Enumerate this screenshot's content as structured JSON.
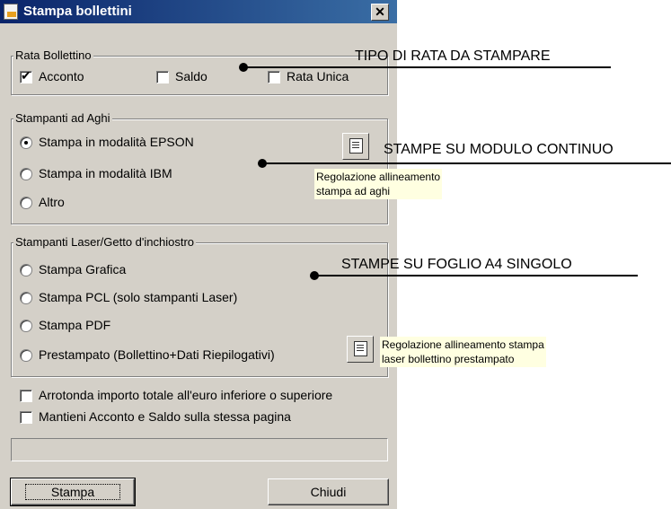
{
  "window": {
    "title": "Stampa bollettini",
    "close_glyph": "✕"
  },
  "rata": {
    "legend": "Rata Bollettino",
    "acconto": {
      "label": "Acconto",
      "checked": true
    },
    "saldo": {
      "label": "Saldo",
      "checked": false
    },
    "unica": {
      "label": "Rata Unica",
      "checked": false
    }
  },
  "aghi": {
    "legend": "Stampanti ad Aghi",
    "options": [
      {
        "label": "Stampa in modalità EPSON",
        "selected": true
      },
      {
        "label": "Stampa in modalità IBM",
        "selected": false
      },
      {
        "label": "Altro",
        "selected": false
      }
    ],
    "tooltip_line1": "Regolazione allineamento",
    "tooltip_line2": "stampa ad aghi"
  },
  "laser": {
    "legend": "Stampanti Laser/Getto d'inchiostro",
    "options": [
      {
        "label": "Stampa Grafica",
        "selected": false
      },
      {
        "label": "Stampa PCL (solo stampanti Laser)",
        "selected": false
      },
      {
        "label": "Stampa PDF",
        "selected": false
      },
      {
        "label": "Prestampato (Bollettino+Dati Riepilogativi)",
        "selected": false
      }
    ],
    "tooltip_line1": "Regolazione allineamento stampa",
    "tooltip_line2": "laser bollettino prestampato"
  },
  "options": {
    "arrotonda": "Arrotonda importo totale all'euro inferiore o superiore",
    "mantieni": "Mantieni Acconto e Saldo sulla stessa pagina"
  },
  "buttons": {
    "stampa": "Stampa",
    "chiudi": "Chiudi"
  },
  "annotations": {
    "tipo": "TIPO DI RATA DA STAMPARE",
    "continuo": "STAMPE SU MODULO CONTINUO",
    "a4": "STAMPE SU FOGLIO A4 SINGOLO"
  }
}
